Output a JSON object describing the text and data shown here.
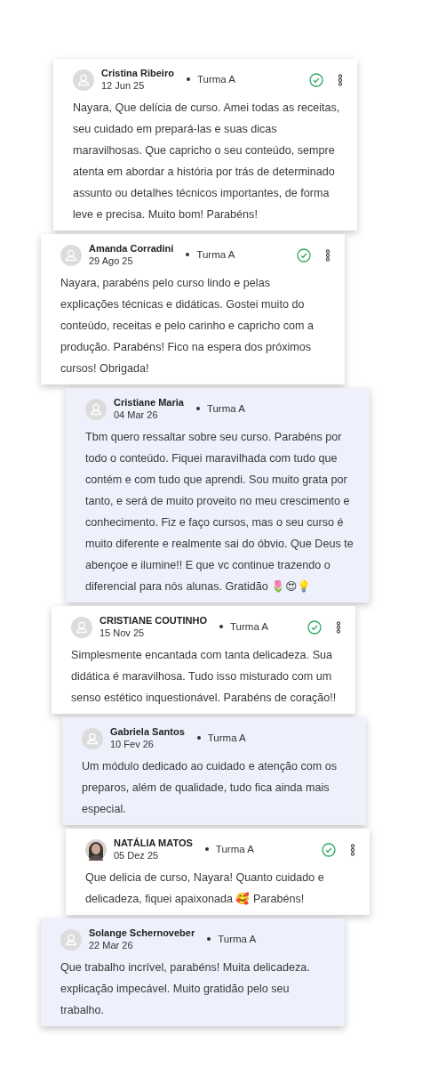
{
  "reviews": [
    {
      "name": "Cristina Ribeiro",
      "date": "12 Jun 25",
      "group": "Turma A",
      "approved": true,
      "has_photo": false,
      "text": "Nayara, Que delícia de curso. Amei todas as receitas, seu cuidado em prepará-las e suas dicas maravilhosas. Que capricho o seu conteúdo, sempre atenta em abordar a história por trás de determinado assunto ou detalhes técnicos importantes, de forma leve e precisa. Muito bom! Parabéns!"
    },
    {
      "name": "Amanda Corradini",
      "date": "29 Ago 25",
      "group": "Turma A",
      "approved": true,
      "has_photo": false,
      "text": "Nayara, parabéns pelo curso lindo e pelas explicações técnicas e didáticas. Gostei muito do conteúdo, receitas e pelo carinho e capricho com a produção. Parabéns! Fico na espera dos próximos cursos! Obrigada!"
    },
    {
      "name": "Cristiane Maria",
      "date": "04 Mar 26",
      "group": "Turma A",
      "approved": false,
      "has_photo": false,
      "text": "Tbm quero ressaltar sobre seu curso. Parabéns por todo o conteúdo. Fiquei maravilhada com tudo que contém e com tudo que aprendi. Sou muito grata por tanto, e será de muito proveito no meu crescimento e conhecimento. Fiz e faço cursos, mas o seu curso é muito diferente e realmente sai do óbvio. Que Deus te abençoe e ilumine!! E que vc continue trazendo o diferencial para nós alunas. Gratidão 🌷😍💡"
    },
    {
      "name": "CRISTIANE COUTINHO",
      "date": "15 Nov 25",
      "group": "Turma A",
      "approved": true,
      "has_photo": false,
      "text": "Simplesmente encantada com tanta delicadeza. Sua didática é maravilhosa. Tudo isso misturado com um senso estético inquestionável. Parabéns de coração!!"
    },
    {
      "name": "Gabriela Santos",
      "date": "10 Fev 26",
      "group": "Turma A",
      "approved": false,
      "has_photo": false,
      "text": "Um módulo dedicado ao cuidado e atenção com os preparos, além de qualidade, tudo fica ainda mais especial."
    },
    {
      "name": "NATÁLIA MATOS",
      "date": "05 Dez 25",
      "group": "Turma A",
      "approved": true,
      "has_photo": true,
      "text": "Que delicia de curso, Nayara! Quanto cuidado e delicadeza, fiquei apaixonada 🥰 Parabéns!"
    },
    {
      "name": "Solange Schernoveber",
      "date": "22 Mar 26",
      "group": "Turma A",
      "approved": false,
      "has_photo": false,
      "text": "Que trabalho incrível, parabéns! Muita delicadeza. explicação impecável. Muito gratidão pelo seu trabalho."
    }
  ]
}
